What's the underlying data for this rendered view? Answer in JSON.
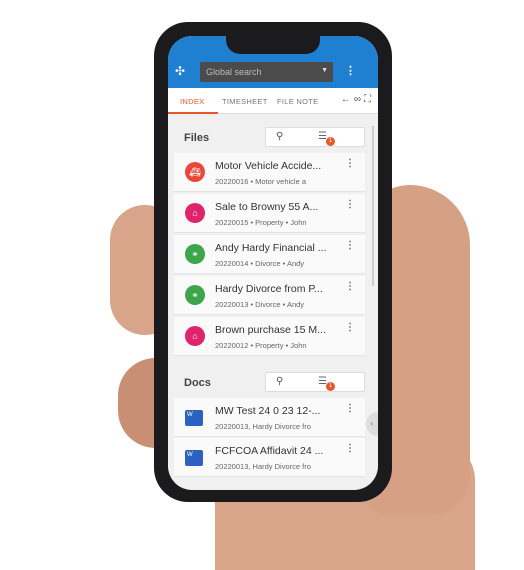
{
  "header": {
    "search_placeholder": "Global search"
  },
  "tabs": [
    {
      "label": "INDEX",
      "active": true
    },
    {
      "label": "TIMESHEET"
    },
    {
      "label": "FILE NOTE"
    }
  ],
  "files": {
    "title": "Files",
    "filter_count": "1",
    "items": [
      {
        "title": "Motor Vehicle Accide...",
        "sub": "20220016  • Motor vehicle a",
        "icon": "ambulance-icon",
        "color": "#e8483a"
      },
      {
        "title": "Sale to Browny 55 A...",
        "sub": "20220015  • Property  • John",
        "icon": "property-icon",
        "color": "#e0246b"
      },
      {
        "title": "Andy Hardy Financial ...",
        "sub": "20220014  • Divorce  • Andy",
        "icon": "divorce-icon",
        "color": "#3fa54a"
      },
      {
        "title": "Hardy Divorce from P...",
        "sub": "20220013  • Divorce  • Andy",
        "icon": "divorce-icon",
        "color": "#3fa54a"
      },
      {
        "title": "Brown purchase 15 M...",
        "sub": "20220012  • Property  • John",
        "icon": "property-icon",
        "color": "#e0246b"
      }
    ]
  },
  "docs": {
    "title": "Docs",
    "filter_count": "1",
    "items": [
      {
        "title": "MW Test 24 0 23 12-...",
        "sub": "20220013, Hardy Divorce fro"
      },
      {
        "title": "FCFCOA Affidavit 24 ...",
        "sub": "20220013, Hardy Divorce fro"
      }
    ]
  },
  "colors": {
    "header": "#1f7fd0",
    "accent": "#e8572a"
  }
}
